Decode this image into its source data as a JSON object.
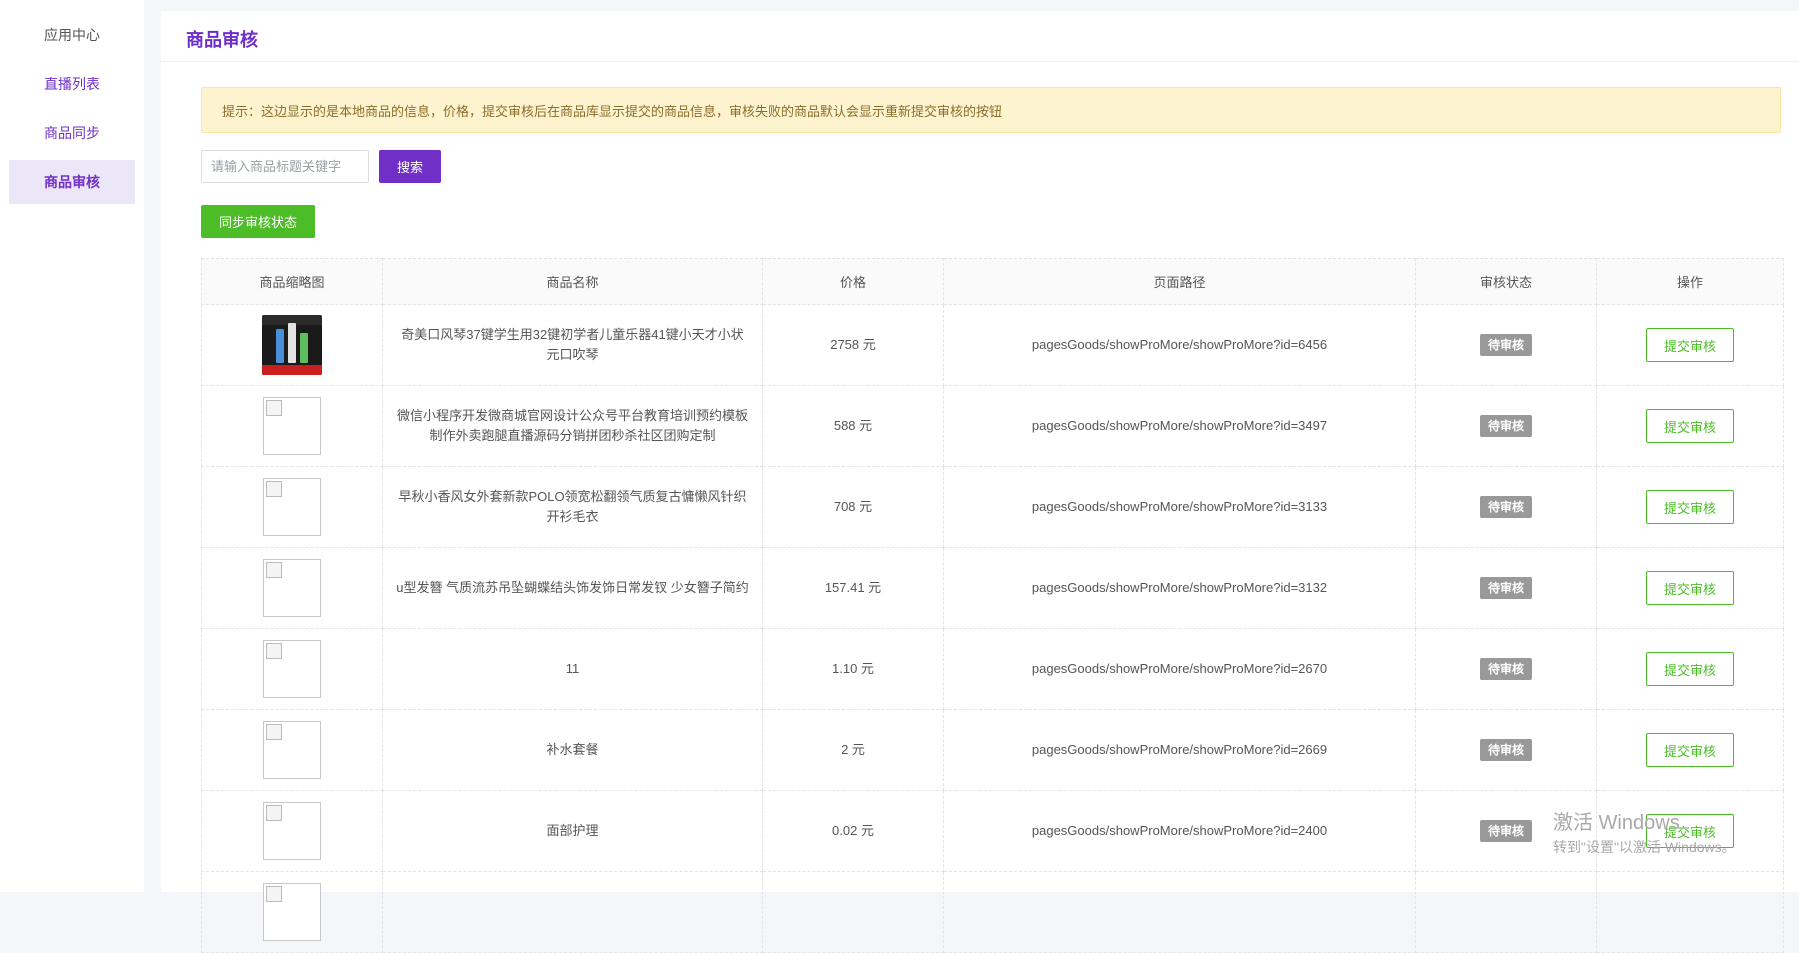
{
  "sidebar": {
    "items": [
      {
        "label": "应用中心"
      },
      {
        "label": "直播列表"
      },
      {
        "label": "商品同步"
      },
      {
        "label": "商品审核"
      }
    ]
  },
  "page": {
    "title": "商品审核"
  },
  "notice": "提示：这边显示的是本地商品的信息，价格，提交审核后在商品库显示提交的商品信息，审核失败的商品默认会显示重新提交审核的按钮",
  "search": {
    "placeholder": "请输入商品标题关键字",
    "button": "搜索"
  },
  "sync_button": "同步审核状态",
  "table": {
    "headers": [
      "商品缩略图",
      "商品名称",
      "价格",
      "页面路径",
      "审核状态",
      "操作"
    ],
    "rows": [
      {
        "name": "奇美口风琴37键学生用32键初学者儿童乐器41键小天才小状元口吹琴",
        "price": "2758 元",
        "path": "pagesGoods/showProMore/showProMore?id=6456",
        "status": "待审核",
        "action": "提交审核"
      },
      {
        "name": "微信小程序开发微商城官网设计公众号平台教育培训预约模板制作外卖跑腿直播源码分销拼团秒杀社区团购定制",
        "price": "588 元",
        "path": "pagesGoods/showProMore/showProMore?id=3497",
        "status": "待审核",
        "action": "提交审核"
      },
      {
        "name": "早秋小香风女外套新款POLO领宽松翻领气质复古慵懒风针织开衫毛衣",
        "price": "708 元",
        "path": "pagesGoods/showProMore/showProMore?id=3133",
        "status": "待审核",
        "action": "提交审核"
      },
      {
        "name": "u型发簪 气质流苏吊坠蝴蝶结头饰发饰日常发钗 少女簪子简约",
        "price": "157.41 元",
        "path": "pagesGoods/showProMore/showProMore?id=3132",
        "status": "待审核",
        "action": "提交审核"
      },
      {
        "name": "11",
        "price": "1.10 元",
        "path": "pagesGoods/showProMore/showProMore?id=2670",
        "status": "待审核",
        "action": "提交审核"
      },
      {
        "name": "补水套餐",
        "price": "2 元",
        "path": "pagesGoods/showProMore/showProMore?id=2669",
        "status": "待审核",
        "action": "提交审核"
      },
      {
        "name": "面部护理",
        "price": "0.02 元",
        "path": "pagesGoods/showProMore/showProMore?id=2400",
        "status": "待审核",
        "action": "提交审核"
      },
      {
        "name": "",
        "price": "",
        "path": "",
        "status": "",
        "action": ""
      }
    ]
  },
  "watermark": {
    "line1": "激活 Windows",
    "line2": "转到\"设置\"以激活 Windows。"
  },
  "colors": {
    "accent": "#7030c8",
    "success": "#4cbd27",
    "notice_bg": "#fef3cf",
    "badge": "#999999"
  }
}
